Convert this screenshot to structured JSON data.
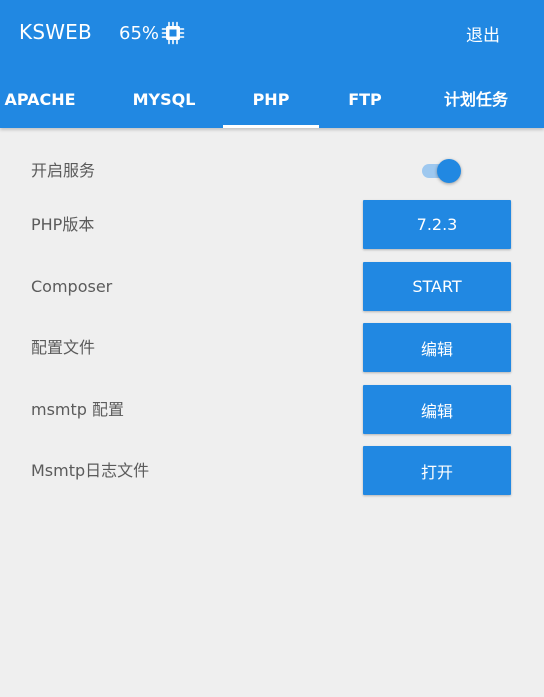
{
  "header": {
    "title": "KSWEB",
    "cpu_usage": "65%",
    "cpu_icon": "cpu-chip-icon",
    "exit_label": "退出"
  },
  "tabs": [
    {
      "label": "APACHE",
      "active": false
    },
    {
      "label": "MYSQL",
      "active": false
    },
    {
      "label": "PHP",
      "active": true
    },
    {
      "label": "FTP",
      "active": false
    },
    {
      "label": "计划任务",
      "active": false
    }
  ],
  "settings": {
    "service": {
      "label": "开启服务",
      "enabled": true
    },
    "php_version": {
      "label": "PHP版本",
      "value": "7.2.3"
    },
    "composer": {
      "label": "Composer",
      "button": "START"
    },
    "config_file": {
      "label": "配置文件",
      "button": "编辑"
    },
    "msmtp_config": {
      "label": "msmtp 配置",
      "button": "编辑"
    },
    "msmtp_log": {
      "label": "Msmtp日志文件",
      "button": "打开"
    }
  },
  "colors": {
    "primary": "#2188e2",
    "background": "#efefef",
    "label_text": "#5b5b5b",
    "switch_track": "#9ec8ef"
  }
}
